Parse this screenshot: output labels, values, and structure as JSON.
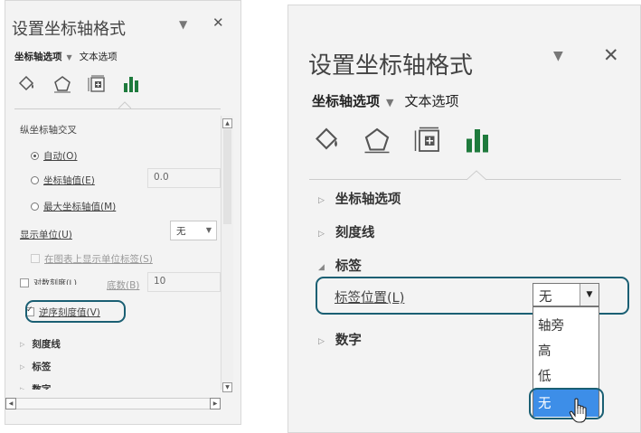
{
  "left_panel": {
    "title": "设置坐标轴格式",
    "dropdown_icon": "chevron-down-icon",
    "close_icon": "close-icon",
    "tab_axis_options": "坐标轴选项",
    "tab_text_options": "文本选项",
    "icons": [
      "fill-line-icon",
      "effects-pentagon-icon",
      "size-properties-icon",
      "bar-chart-icon"
    ],
    "vertical_axis_crosses": "纵坐标轴交叉",
    "radio_auto": "自动(O)",
    "radio_axis_value": "坐标轴值(E)",
    "axis_value_input": "0.0",
    "radio_max_axis_value": "最大坐标轴值(M)",
    "display_units_label": "显示单位(U)",
    "display_units_value": "无",
    "show_units_label": "在图表上显示单位标签(S)",
    "log_scale_label": "对数刻度(L)",
    "log_base_label": "底数(B)",
    "log_base_value": "10",
    "reverse_order_label": "逆序刻度值(V)",
    "reverse_order_checked": true,
    "section_tick_marks": "刻度线",
    "section_labels": "标签",
    "section_number": "数字"
  },
  "right_panel": {
    "title": "设置坐标轴格式",
    "dropdown_icon": "chevron-down-icon",
    "close_icon": "close-icon",
    "tab_axis_options": "坐标轴选项",
    "tab_text_options": "文本选项",
    "icons": [
      "fill-line-icon",
      "effects-pentagon-icon",
      "size-properties-icon",
      "bar-chart-icon"
    ],
    "section_axis_options": "坐标轴选项",
    "section_tick_marks": "刻度线",
    "section_labels": "标签",
    "label_position_label": "标签位置(L)",
    "label_position_value": "无",
    "options": [
      "轴旁",
      "高",
      "低",
      "无"
    ],
    "selected_option": "无",
    "section_number": "数字"
  },
  "colors": {
    "panel_bg": "#f3f3f3",
    "highlight_border": "#1a5f73",
    "chart_icon_green": "#1e7a3c",
    "selected_option_bg": "#3d8ee8"
  }
}
